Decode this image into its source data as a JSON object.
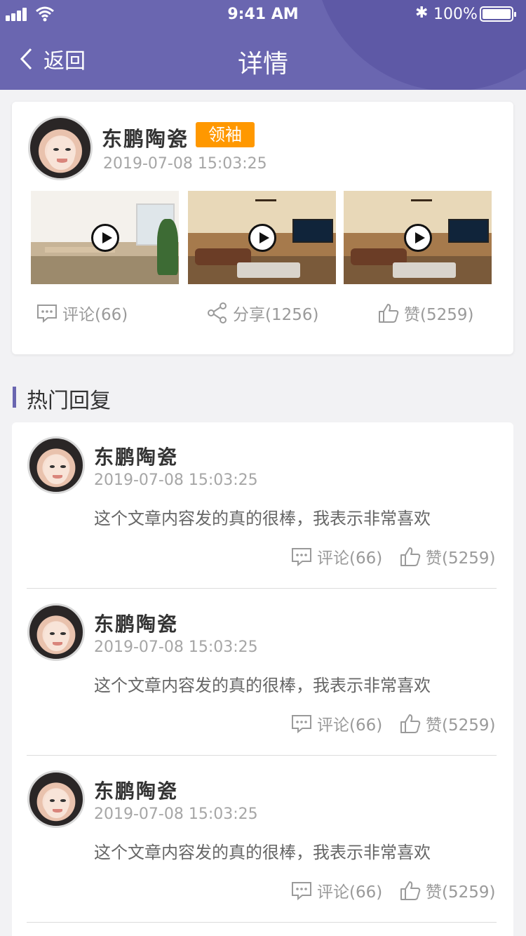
{
  "status_bar": {
    "time": "9:41 AM",
    "battery": "100%",
    "bluetooth_glyph": "✱"
  },
  "nav": {
    "back_label": "返回",
    "title": "详情"
  },
  "post": {
    "author": "东鹏陶瓷",
    "badge": "领袖",
    "time": "2019-07-08 15:03:25",
    "media": [
      "video-thumbnail",
      "video-thumbnail",
      "video-thumbnail"
    ],
    "actions": {
      "comment": "评论(66)",
      "share": "分享(1256)",
      "like": "赞(5259)"
    }
  },
  "section": {
    "title": "热门回复"
  },
  "replies": [
    {
      "author": "东鹏陶瓷",
      "time": "2019-07-08 15:03:25",
      "text": "这个文章内容发的真的很棒，我表示非常喜欢",
      "comment": "评论(66)",
      "like": "赞(5259)"
    },
    {
      "author": "东鹏陶瓷",
      "time": "2019-07-08 15:03:25",
      "text": "这个文章内容发的真的很棒，我表示非常喜欢",
      "comment": "评论(66)",
      "like": "赞(5259)"
    },
    {
      "author": "东鹏陶瓷",
      "time": "2019-07-08 15:03:25",
      "text": "这个文章内容发的真的很棒，我表示非常喜欢",
      "comment": "评论(66)",
      "like": "赞(5259)"
    }
  ],
  "colors": {
    "header": "#6a66b0",
    "badge": "#ff9800",
    "accent": "#6a66b0",
    "muted": "#9a9a9a"
  }
}
